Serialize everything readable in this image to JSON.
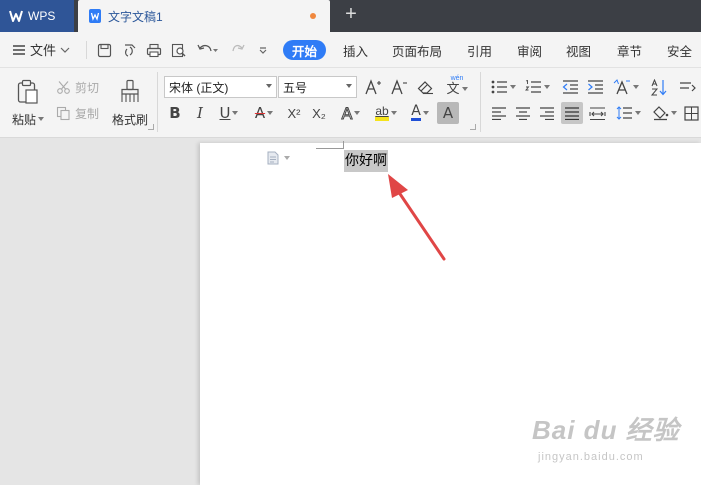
{
  "titlebar": {
    "app_name": "WPS",
    "doc_tab_title": "文字文稿1",
    "new_tab": "+"
  },
  "menubar": {
    "file_label": "文件",
    "tabs": [
      {
        "label": "开始",
        "active": true
      },
      {
        "label": "插入"
      },
      {
        "label": "页面布局"
      },
      {
        "label": "引用"
      },
      {
        "label": "审阅"
      },
      {
        "label": "视图"
      },
      {
        "label": "章节"
      },
      {
        "label": "安全"
      }
    ]
  },
  "ribbon": {
    "paste_label": "粘贴",
    "cut_label": "剪切",
    "copy_label": "复制",
    "format_painter_label": "格式刷",
    "font_name": "宋体 (正文)",
    "font_size": "五号",
    "bold_label": "B",
    "italic_label": "I",
    "underline_label": "U",
    "strikethrough_label": "A",
    "superscript_label": "X²",
    "subscript_label": "X₂",
    "text_effect_label": "A",
    "highlight_label": "ab",
    "font_color_label": "A",
    "char_shading_label": "A",
    "phonetic_label": "文",
    "phonetic_top": "wén"
  },
  "document": {
    "text": "你好啊"
  },
  "watermark": {
    "line1": "Bai du 经验",
    "line2": "jingyan.baidu.com"
  },
  "colors": {
    "accent": "#2f7cf6",
    "app_tab": "#2f5597",
    "titlebar": "#3c3f45",
    "arrow": "#e04646",
    "highlight": "#f5e31c",
    "font_color": "#1f4fd6"
  }
}
